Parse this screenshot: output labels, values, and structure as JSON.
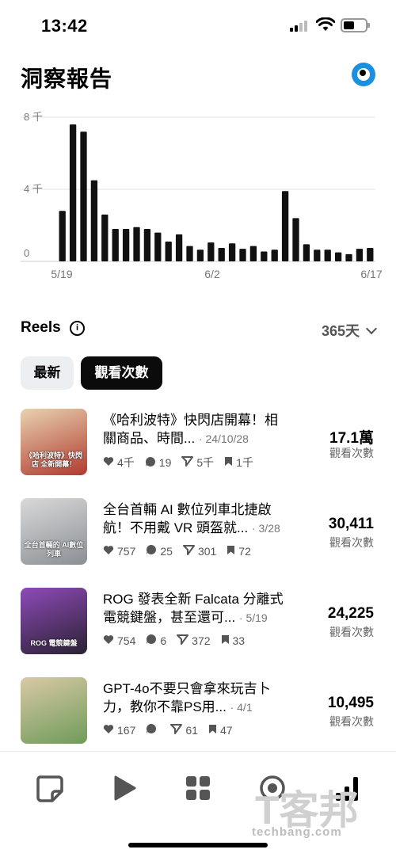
{
  "status_bar": {
    "time": "13:42"
  },
  "header": {
    "title": "洞察報告",
    "eye_icon": "eye-icon"
  },
  "chart_data": {
    "type": "bar",
    "x_start_label": "5/19",
    "x_mid_label": "6/2",
    "x_end_label": "6/17",
    "y_ticks": [
      "8 千",
      "4 千",
      "0"
    ],
    "ylim": [
      0,
      8000
    ],
    "grid": true,
    "values": [
      2800,
      7600,
      7200,
      4500,
      2600,
      1800,
      1800,
      1900,
      1800,
      1600,
      1100,
      1500,
      850,
      650,
      1050,
      750,
      1000,
      700,
      850,
      550,
      650,
      3900,
      2400,
      950,
      650,
      650,
      500,
      400,
      700,
      750
    ]
  },
  "reels": {
    "title": "Reels",
    "range": "365天",
    "filters": {
      "latest": "最新",
      "views": "觀看次數"
    },
    "items": [
      {
        "title_line1": "《哈利波特》快閃店開幕！相",
        "title_line2": "關商品、時間...",
        "date": "· 24/10/28",
        "likes": "4千",
        "comments": "19",
        "shares": "5千",
        "saves": "1千",
        "views": "17.1萬",
        "views_label": "觀看次數",
        "thumb_text": "《哈利波特》快閃店 全新開幕！",
        "thumb_colors": [
          "#b03a2e",
          "#e8d3b0"
        ]
      },
      {
        "title_line1": "全台首輛 AI 數位列車北捷啟",
        "title_line2": "航！不用戴 VR 頭盔就...",
        "date": "· 3/28",
        "likes": "757",
        "comments": "25",
        "shares": "301",
        "saves": "72",
        "views": "30,411",
        "views_label": "觀看次數",
        "thumb_text": "全台首輛的 AI數位列車",
        "thumb_colors": [
          "#8a8f94",
          "#d9d9d9"
        ]
      },
      {
        "title_line1": "ROG 發表全新 Falcata 分離式",
        "title_line2": "電競鍵盤，甚至還可...",
        "date": "· 5/19",
        "likes": "754",
        "comments": "6",
        "shares": "372",
        "saves": "33",
        "views": "24,225",
        "views_label": "觀看次數",
        "thumb_text": "ROG 電競鍵盤",
        "thumb_colors": [
          "#2a2233",
          "#8e4ab8"
        ]
      },
      {
        "title_line1": "GPT-4o不要只會拿來玩吉卜",
        "title_line2": "力，教你不靠PS用...",
        "date": "· 4/1",
        "likes": "167",
        "comments": "",
        "shares": "61",
        "saves": "47",
        "views": "10,495",
        "views_label": "觀看次數",
        "thumb_text": "",
        "thumb_colors": [
          "#6f9b5a",
          "#d9c9a5"
        ]
      }
    ]
  },
  "bottom_nav": {
    "items": [
      "sticky-note-icon",
      "play-icon",
      "grid-icon",
      "circle-icon",
      "insights-icon"
    ]
  },
  "watermark": {
    "text": "T客邦",
    "site": "techbang.com"
  }
}
